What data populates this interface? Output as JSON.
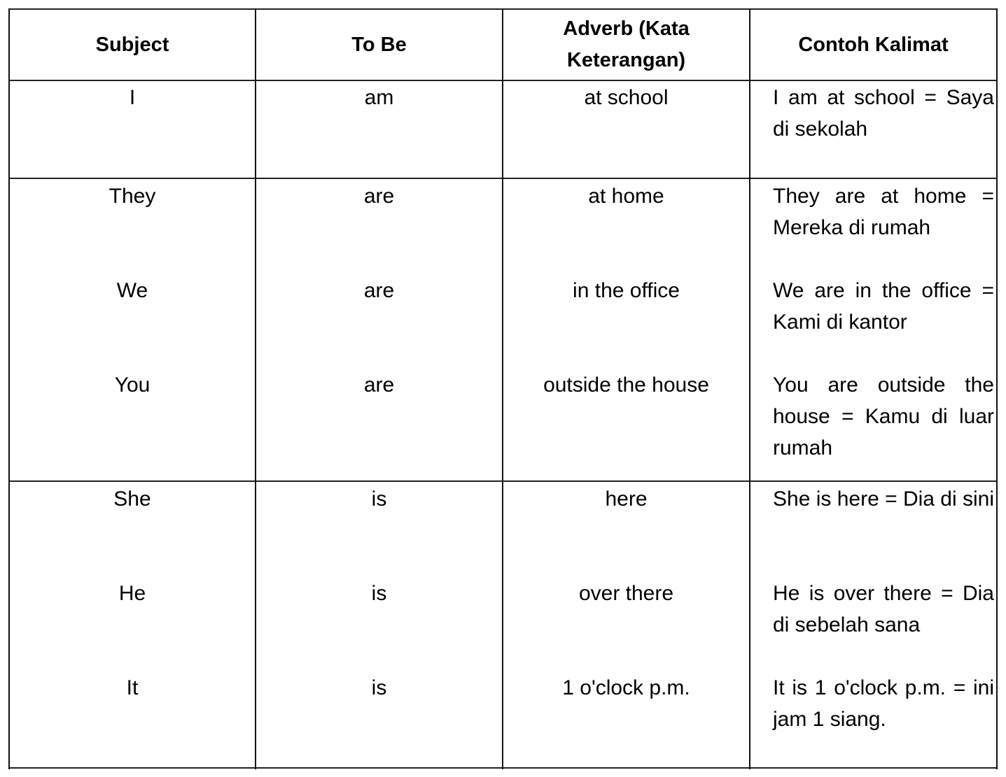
{
  "table": {
    "headers": {
      "subject": "Subject",
      "to_be": "To Be",
      "adverb": "Adverb (Kata Keterangan)",
      "example": "Contoh Kalimat"
    },
    "groups": [
      {
        "rows": [
          {
            "subject": "I",
            "to_be": "am",
            "adverb": "at school",
            "example": "I am at school = Saya di sekolah"
          }
        ]
      },
      {
        "rows": [
          {
            "subject": "They",
            "to_be": "are",
            "adverb": "at home",
            "example": "They are at home = Mereka di rumah"
          },
          {
            "subject": "We",
            "to_be": "are",
            "adverb": "in the office",
            "example": "We are in the office = Kami di kantor"
          },
          {
            "subject": "You",
            "to_be": "are",
            "adverb": "outside the house",
            "example": "You are outside the house = Kamu di luar rumah"
          }
        ]
      },
      {
        "rows": [
          {
            "subject": "She",
            "to_be": "is",
            "adverb": "here",
            "example": "She is here = Dia di sini"
          },
          {
            "subject": "He",
            "to_be": "is",
            "adverb": "over there",
            "example": "He is over there = Dia di sebelah sana"
          },
          {
            "subject": "It",
            "to_be": "is",
            "adverb": "1 o'clock p.m.",
            "example": "It is 1 o'clock p.m. = ini jam 1 siang."
          }
        ]
      }
    ]
  }
}
